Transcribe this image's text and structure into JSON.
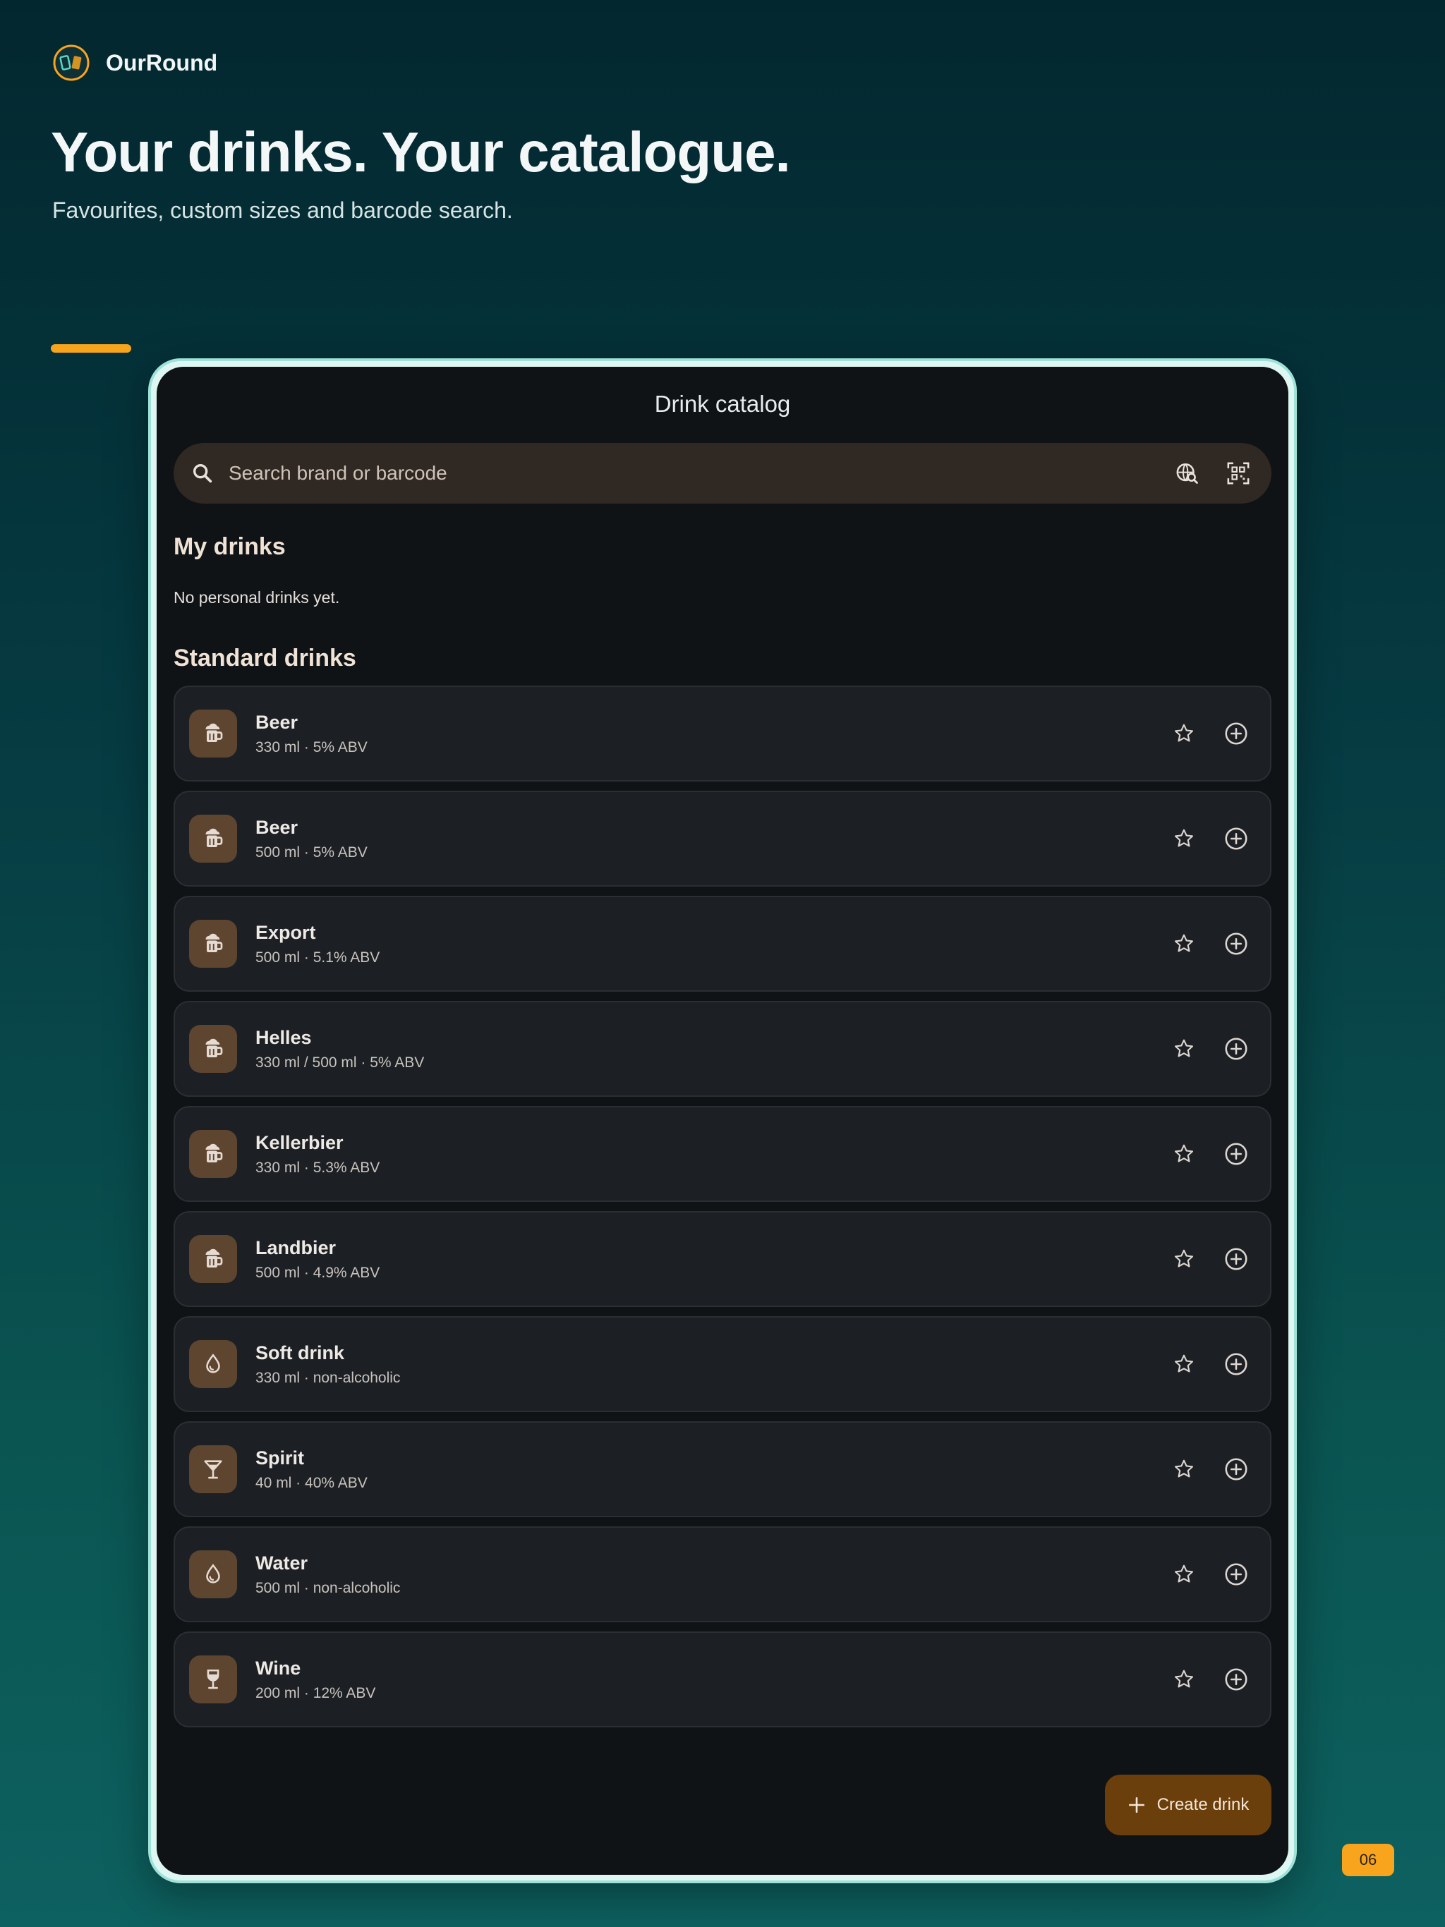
{
  "brand": {
    "name": "OurRound"
  },
  "hero": {
    "title": "Your drinks. Your catalogue.",
    "subtitle": "Favourites, custom sizes and barcode search."
  },
  "app": {
    "title": "Drink catalog",
    "search": {
      "placeholder": "Search brand or barcode",
      "value": ""
    },
    "my_drinks": {
      "title": "My drinks",
      "empty_text": "No personal drinks yet."
    },
    "standard_drinks": {
      "title": "Standard drinks",
      "items": [
        {
          "name": "Beer",
          "meta": "330 ml · 5% ABV",
          "icon": "beer-mug-icon"
        },
        {
          "name": "Beer",
          "meta": "500 ml · 5% ABV",
          "icon": "beer-mug-icon"
        },
        {
          "name": "Export",
          "meta": "500 ml · 5.1% ABV",
          "icon": "beer-mug-icon"
        },
        {
          "name": "Helles",
          "meta": "330 ml / 500 ml · 5% ABV",
          "icon": "beer-mug-icon"
        },
        {
          "name": "Kellerbier",
          "meta": "330 ml · 5.3% ABV",
          "icon": "beer-mug-icon"
        },
        {
          "name": "Landbier",
          "meta": "500 ml · 4.9% ABV",
          "icon": "beer-mug-icon"
        },
        {
          "name": "Soft drink",
          "meta": "330 ml · non-alcoholic",
          "icon": "water-drop-icon"
        },
        {
          "name": "Spirit",
          "meta": "40 ml · 40% ABV",
          "icon": "cocktail-glass-icon"
        },
        {
          "name": "Water",
          "meta": "500 ml · non-alcoholic",
          "icon": "water-drop-icon"
        },
        {
          "name": "Wine",
          "meta": "200 ml · 12% ABV",
          "icon": "wine-glass-icon"
        }
      ]
    },
    "fab": {
      "label": "Create drink"
    }
  },
  "page_number": "06",
  "colors": {
    "accent": "#f8a51d",
    "fab": "#6b3f0b",
    "icon_tile": "#5e4530",
    "screen_bg": "#0f1316"
  }
}
